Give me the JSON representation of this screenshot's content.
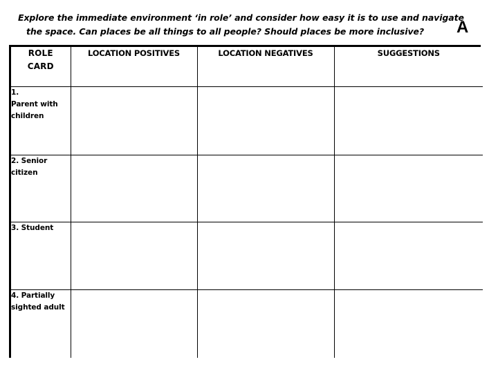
{
  "header": {
    "prompt_line_1": "Explore the immediate environment ‘in role’ and consider how easy it is to use and navigate",
    "prompt_line_2": "the space. Can places be all things to all people? Should places be more inclusive?",
    "sheet_letter": "A"
  },
  "table": {
    "columns": [
      {
        "id": "role-card",
        "label": "ROLE\nCARD"
      },
      {
        "id": "location-positives",
        "label": "LOCATION POSITIVES"
      },
      {
        "id": "location-negatives",
        "label": "LOCATION NEGATIVES"
      },
      {
        "id": "suggestions",
        "label": "SUGGESTIONS"
      }
    ],
    "rows": [
      {
        "id": "row-1",
        "role_card": "1.\nParent with children",
        "location_positives": "",
        "location_negatives": "",
        "suggestions": ""
      },
      {
        "id": "row-2",
        "role_card": "2. Senior citizen",
        "location_positives": "",
        "location_negatives": "",
        "suggestions": ""
      },
      {
        "id": "row-3",
        "role_card": "3. Student",
        "location_positives": "",
        "location_negatives": "",
        "suggestions": ""
      },
      {
        "id": "row-4",
        "role_card": "4. Partially sighted adult",
        "location_positives": "",
        "location_negatives": "",
        "suggestions": ""
      }
    ]
  },
  "colors": {
    "page_background": "#ffffff",
    "text": "#000000",
    "border": "#000000"
  }
}
